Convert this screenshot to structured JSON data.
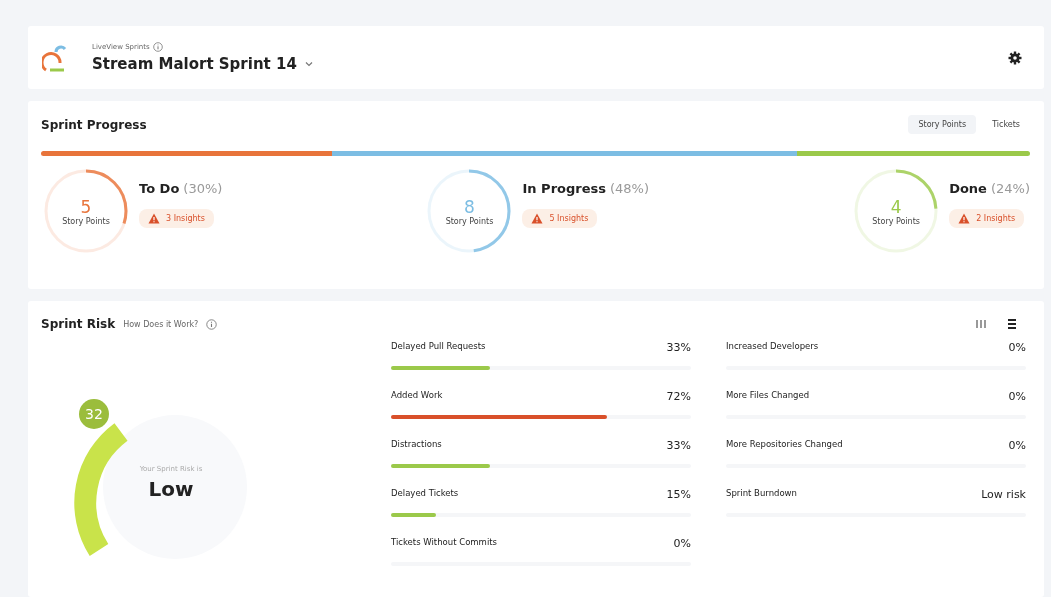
{
  "header": {
    "app_name": "LiveView Sprints",
    "sprint_title": "Stream Malort Sprint 14"
  },
  "sprint_progress": {
    "title": "Sprint Progress",
    "toggle": [
      {
        "label": "Story Points",
        "selected": true
      },
      {
        "label": "Tickets",
        "selected": false
      }
    ],
    "statuses": [
      {
        "kind": "todo",
        "name": "To Do",
        "percent": "(30%)",
        "points": "5",
        "points_label": "Story Points",
        "insights": "3 Insights",
        "color": "#e8743b"
      },
      {
        "kind": "progress",
        "name": "In Progress",
        "percent": "(48%)",
        "points": "8",
        "points_label": "Story Points",
        "insights": "5 Insights",
        "color": "#7cbde3"
      },
      {
        "kind": "done",
        "name": "Done",
        "percent": "(24%)",
        "points": "4",
        "points_label": "Story Points",
        "insights": "2 Insights",
        "color": "#9bc94a"
      }
    ]
  },
  "sprint_risk": {
    "title": "Sprint Risk",
    "help_link": "How Does it Work?",
    "score": "32",
    "caption": "Your Sprint Risk is",
    "rating": "Low",
    "factors": [
      {
        "name": "Delayed Pull Requests",
        "value": "33%",
        "level": 0.33
      },
      {
        "name": "Added Work",
        "value": "72%",
        "level": 0.72
      },
      {
        "name": "Distractions",
        "value": "33%",
        "level": 0.33
      },
      {
        "name": "Delayed Tickets",
        "value": "15%",
        "level": 0.15
      },
      {
        "name": "Tickets Without Commits",
        "value": "0%"
      },
      {
        "name": "Increased Developers",
        "value": "0%"
      },
      {
        "name": "More Files Changed",
        "value": "0%"
      },
      {
        "name": "More Repositories Changed",
        "value": "0%"
      },
      {
        "name": "Sprint Burndown",
        "value": "Low risk"
      }
    ]
  }
}
